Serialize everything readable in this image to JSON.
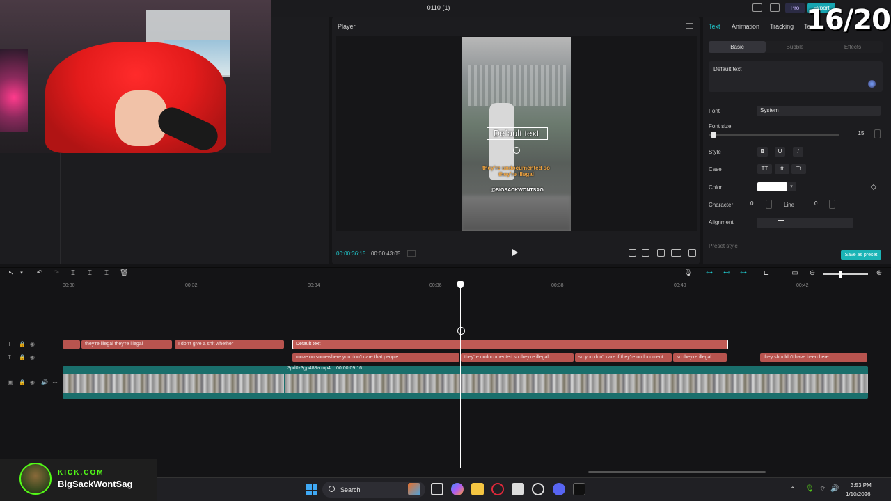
{
  "window": {
    "title": "0110 (1)",
    "pro_label": "Pro",
    "export_label": "Export"
  },
  "overlay": {
    "counter": "16/20",
    "platform": "KICK.COM",
    "streamer": "BigSackWontSag"
  },
  "player": {
    "title": "Player",
    "current_time": "00:00:36:15",
    "total_time": "00:00:43:05",
    "preview_text": "Default text",
    "preview_caption": "they're undocumented so they're illegal",
    "preview_watermark": "@BIGSACKWONTSAG"
  },
  "props": {
    "tabs": [
      "Text",
      "Animation",
      "Tracking",
      "Te"
    ],
    "sub_tabs": [
      "Basic",
      "Bubble",
      "Effects"
    ],
    "text_value": "Default text",
    "font_label": "Font",
    "font_value": "System",
    "font_size_label": "Font size",
    "font_size_value": "15",
    "font_size_fraction": 0.04,
    "style_label": "Style",
    "style_buttons": [
      "B",
      "U",
      "I"
    ],
    "case_label": "Case",
    "case_buttons": [
      "TT",
      "tt",
      "Tt"
    ],
    "color_label": "Color",
    "color_value": "#ffffff",
    "character_label": "Character",
    "character_value": "0",
    "line_label": "Line",
    "line_value": "0",
    "alignment_label": "Alignment",
    "preset_label": "Preset style",
    "save_preset_label": "Save as preset"
  },
  "timeline": {
    "ruler": [
      "00:30",
      "00:32",
      "00:34",
      "00:36",
      "00:38",
      "00:40",
      "00:42"
    ],
    "text_track_1": [
      "they're illegal they're illegal",
      "I don't give a shit whether"
    ],
    "selected_clip": "Default text",
    "subtitle_track": [
      "move on somewhere you don't care that people",
      "they're undocumented so they're illegal",
      "so you don't care if they're undocument",
      "so they're illegal",
      "they shouldn't have been here"
    ],
    "video_clip_name": "3pd0z3gp488a.mp4",
    "video_clip_duration": "00:00:09:16"
  },
  "taskbar": {
    "search": "Search",
    "time": "3:53 PM",
    "date": "1/10/2026"
  },
  "colors": {
    "accent": "#20c5c9",
    "text_clip": "#b8544f",
    "video_clip": "#1a6f6c",
    "kick_green": "#53fc18"
  }
}
